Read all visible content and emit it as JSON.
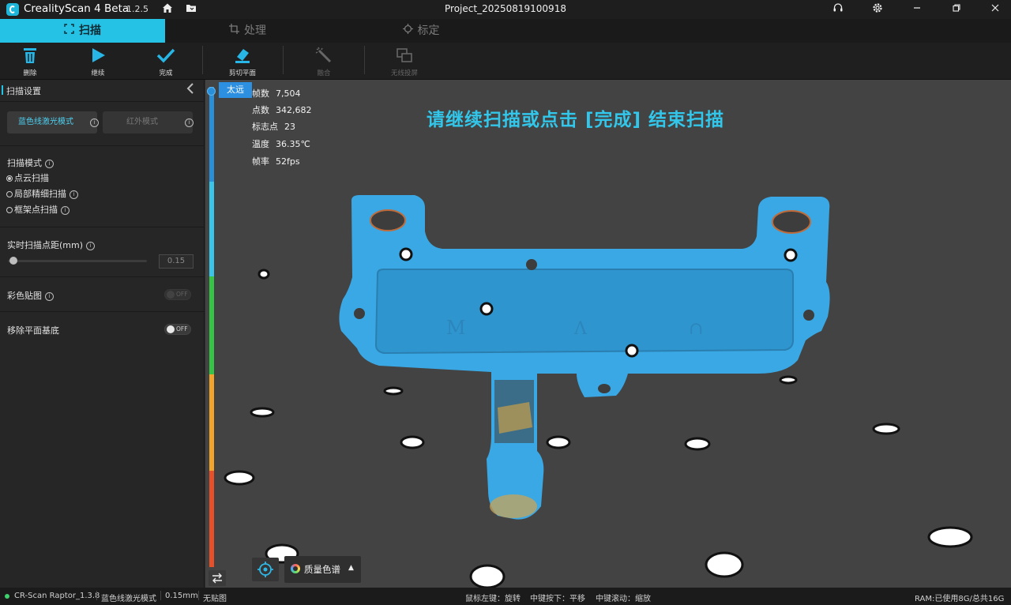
{
  "titlebar": {
    "app_name": "CrealityScan 4 Beta",
    "version": "1.2.5",
    "project": "Project_20250819100918"
  },
  "tabs": [
    {
      "label": "扫描",
      "active": true
    },
    {
      "label": "处理",
      "active": false
    },
    {
      "label": "标定",
      "active": false
    }
  ],
  "toolbar": {
    "delete": "删除",
    "continue": "继续",
    "finish": "完成",
    "cut_plane": "剪切平面",
    "fuse": "融合",
    "wireless": "无线投屏"
  },
  "panel": {
    "title": "扫描设置",
    "mode_blue": "蓝色线激光模式",
    "mode_ir": "红外模式",
    "scan_mode_label": "扫描模式",
    "scan_modes": [
      "点云扫描",
      "局部精细扫描",
      "框架点扫描"
    ],
    "scan_mode_selected": 0,
    "point_distance_label": "实时扫描点距(mm)",
    "point_distance_value": "0.15",
    "color_texture_label": "彩色贴图",
    "color_texture_state": "OFF",
    "remove_plane_label": "移除平面基底",
    "remove_plane_state": "OFF"
  },
  "viewport": {
    "distance_badge": "太远",
    "stats": [
      {
        "label": "帧数",
        "value": "7,504"
      },
      {
        "label": "点数",
        "value": "342,682"
      },
      {
        "label": "标志点",
        "value": "23"
      },
      {
        "label": "温度",
        "value": "36.35℃"
      },
      {
        "label": "帧率",
        "value": "52fps"
      }
    ],
    "hint": "请继续扫描或点击 [完成] 结束扫描",
    "quality_label": "质量色谱"
  },
  "statusbar": {
    "device": "CR-Scan Raptor_1.3.8",
    "mode": "蓝色线激光模式",
    "distance": "0.15mm",
    "texture": "无贴图",
    "mouse_left": "鼠标左键：旋转",
    "mouse_middle": "中键按下：平移",
    "mouse_scroll": "中键滚动：缩放",
    "ram": "RAM:已使用8G/总共16G"
  },
  "colors": {
    "accent": "#26c2e6",
    "scan_blue": "#3aa8e4",
    "badge_blue": "#2c8fe0"
  }
}
